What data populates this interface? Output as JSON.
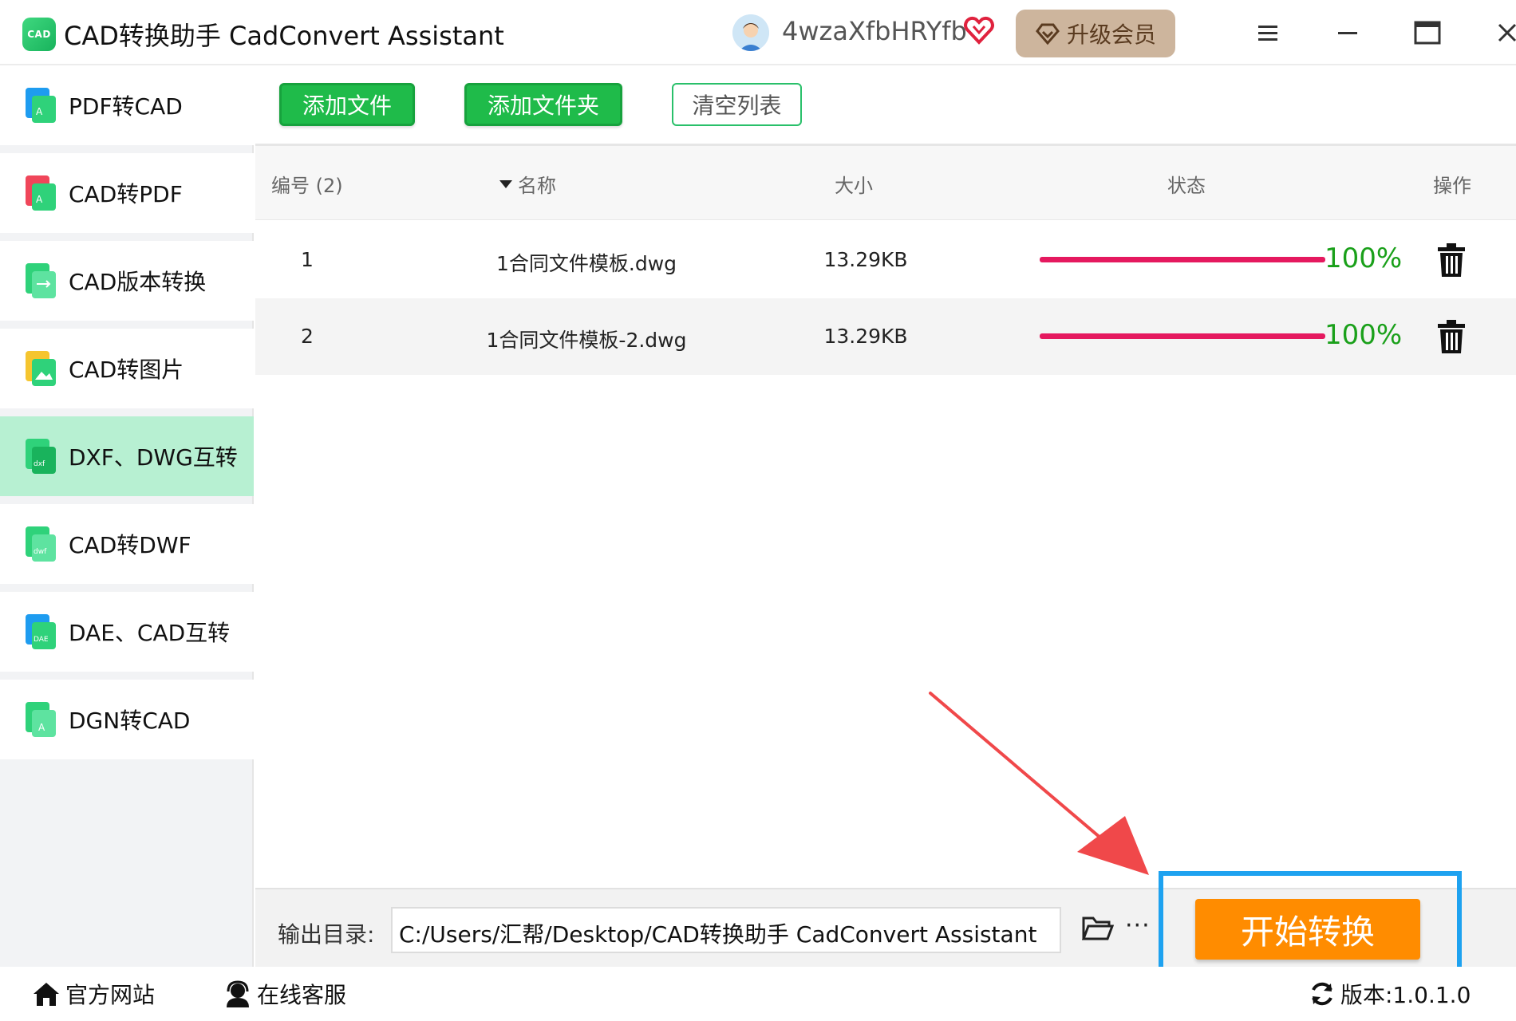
{
  "app": {
    "logo_text": "CAD",
    "title": "CAD转换助手 CadConvert Assistant",
    "username": "4wzaXfbHRYfb",
    "upgrade_label": "升级会员"
  },
  "sidebar": {
    "items": [
      {
        "label": "PDF转CAD",
        "icon": "pdf-to-cad-icon",
        "active": false
      },
      {
        "label": "CAD转PDF",
        "icon": "cad-to-pdf-icon",
        "active": false
      },
      {
        "label": "CAD版本转换",
        "icon": "cad-version-icon",
        "active": false
      },
      {
        "label": "CAD转图片",
        "icon": "cad-to-image-icon",
        "active": false
      },
      {
        "label": "DXF、DWG互转",
        "icon": "dxf-dwg-icon",
        "active": true
      },
      {
        "label": "CAD转DWF",
        "icon": "cad-to-dwf-icon",
        "active": false
      },
      {
        "label": "DAE、CAD互转",
        "icon": "dae-cad-icon",
        "active": false
      },
      {
        "label": "DGN转CAD",
        "icon": "dgn-to-cad-icon",
        "active": false
      }
    ]
  },
  "toolbar": {
    "add_file": "添加文件",
    "add_folder": "添加文件夹",
    "clear_list": "清空列表"
  },
  "table": {
    "headers": {
      "index": "编号 (2)",
      "name": "名称",
      "size": "大小",
      "status": "状态",
      "action": "操作"
    },
    "rows": [
      {
        "index": "1",
        "name": "1合同文件模板.dwg",
        "size": "13.29KB",
        "progress": 1.0,
        "percent": "100%"
      },
      {
        "index": "2",
        "name": "1合同文件模板-2.dwg",
        "size": "13.29KB",
        "progress": 1.0,
        "percent": "100%"
      }
    ]
  },
  "output": {
    "label": "输出目录:",
    "path": "C:/Users/汇帮/Desktop/CAD转换助手 CadConvert Assistant",
    "more": "···"
  },
  "start_button": "开始转换",
  "footer": {
    "website": "官方网站",
    "support": "在线客服",
    "version": "版本:1.0.1.0"
  },
  "colors": {
    "accent_green": "#1fbb4a",
    "active_nav": "#b7f0d2",
    "progress": "#e5195f",
    "percent_text": "#1aa01a",
    "start_button": "#ff8c00",
    "highlight_box": "#1ea2f0",
    "annotation_arrow": "#f0484a"
  }
}
